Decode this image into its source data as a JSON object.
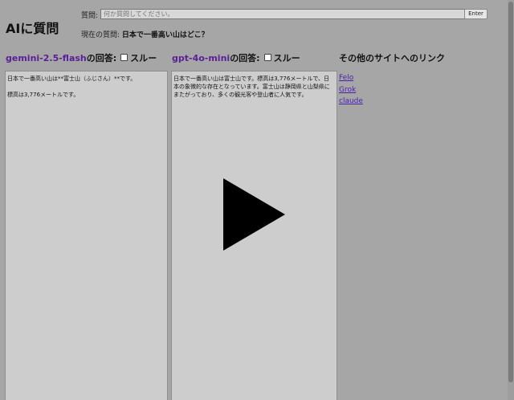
{
  "app": {
    "title": "AIに質問"
  },
  "question": {
    "label": "質問:",
    "placeholder": "何か質問してください。",
    "value": "",
    "enter_label": "Enter"
  },
  "current": {
    "label": "現在の質問:",
    "value": "日本で一番高い山はどこ？"
  },
  "columns": [
    {
      "model": "gemini-2.5-flash",
      "suffix": "の回答:",
      "skip_label": "スルー",
      "skip_checked": false,
      "answer_paragraphs": [
        "日本で一番高い山は**富士山（ふじさん）**です。",
        "標高は3,776メートルです。"
      ]
    },
    {
      "model": "gpt-4o-mini",
      "suffix": "の回答:",
      "skip_label": "スルー",
      "skip_checked": false,
      "answer_paragraphs": [
        "日本で一番高い山は富士山です。標高は3,776メートルで、日本の象徴的な存在となっています。富士山は静岡県と山梨県にまたがっており、多くの観光客や登山者に人気です。"
      ]
    }
  ],
  "links_section": {
    "title": "その他のサイトへのリンク",
    "links": [
      "Felo",
      "Grok",
      "claude"
    ]
  },
  "overlay": {
    "icon": "play-icon"
  },
  "colors": {
    "background": "#a6a6a6",
    "answer_box": "#cdcdcd",
    "model_name": "#5a1f95",
    "link": "#4a1fb0"
  }
}
